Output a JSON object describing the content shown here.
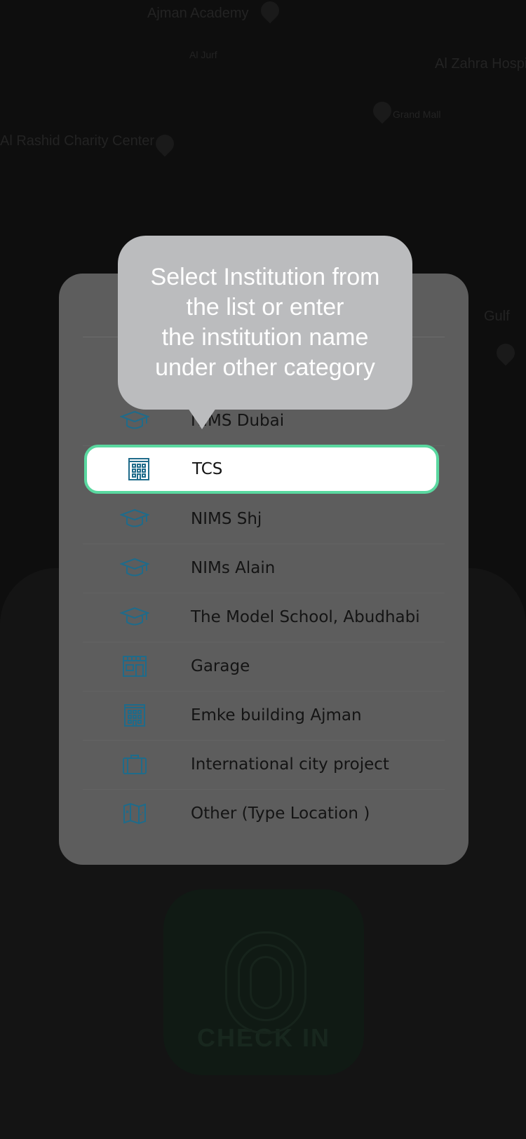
{
  "background": {
    "map_labels": [
      {
        "text": "Ajman Academy",
        "small": false
      },
      {
        "text": "Al Jurf",
        "small": true
      },
      {
        "text": "Al Zahra Hospital",
        "small": false
      },
      {
        "text": "Al Rashid Charity Center",
        "small": false
      },
      {
        "text": "Grand Mall",
        "small": true
      },
      {
        "text": "Gulf",
        "small": false
      }
    ],
    "checkin_label": "CHECK IN"
  },
  "tooltip": {
    "text": "Select Institution from\nthe list or enter\nthe institution name\nunder other category"
  },
  "institutions": [
    {
      "label": "NIMS Dubai",
      "icon": "graduation-cap-icon",
      "selected": false
    },
    {
      "label": "TCS",
      "icon": "office-building-icon",
      "selected": true
    },
    {
      "label": "NIMS Shj",
      "icon": "graduation-cap-icon",
      "selected": false
    },
    {
      "label": "NIMs Alain",
      "icon": "graduation-cap-icon",
      "selected": false
    },
    {
      "label": "The Model School, Abudhabi",
      "icon": "graduation-cap-icon",
      "selected": false
    },
    {
      "label": "Garage",
      "icon": "garage-icon",
      "selected": false
    },
    {
      "label": "Emke building Ajman",
      "icon": "office-building-icon",
      "selected": false
    },
    {
      "label": "International city project",
      "icon": "briefcase-icon",
      "selected": false
    },
    {
      "label": "Other (Type Location )",
      "icon": "map-icon",
      "selected": false
    }
  ],
  "colors": {
    "icon": "#1f6b8a",
    "selection_border": "#5ad8a0",
    "tooltip": "#bbbcbe"
  }
}
